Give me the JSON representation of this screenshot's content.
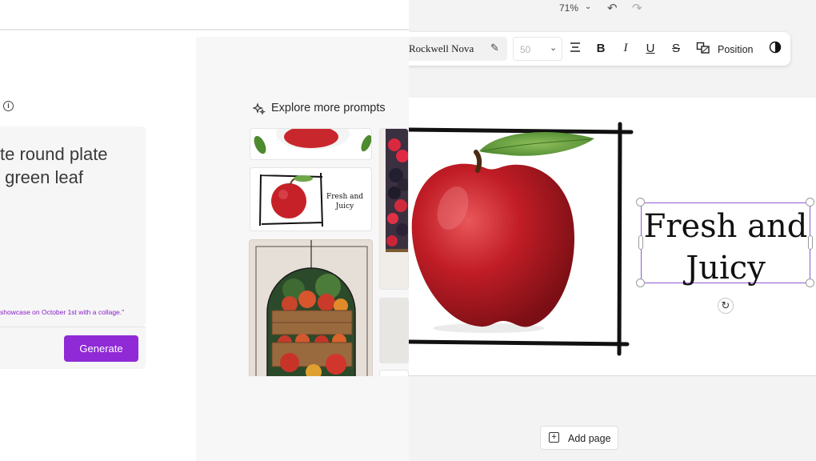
{
  "prompt_panel": {
    "info_icon": "info-icon",
    "prompt_text": "te round plate\n green leaf",
    "suggestion_text": "showcase on October 1st with a collage.\"",
    "generate_label": "Generate"
  },
  "explore": {
    "icon": "sparkle-icon",
    "title": "Explore more prompts",
    "thumbnail_text": "Fresh and\nJuicy"
  },
  "editor": {
    "zoom": "71%",
    "toolbar": {
      "font_name": "Rockwell Nova",
      "font_size": "50",
      "position_label": "Position"
    },
    "canvas": {
      "headline": "Fresh and\nJuicy"
    },
    "add_page_label": "Add page"
  },
  "colors": {
    "accent": "#8f2ad6",
    "selection": "#8f5bd6",
    "suggestion": "#8a1fc9"
  }
}
